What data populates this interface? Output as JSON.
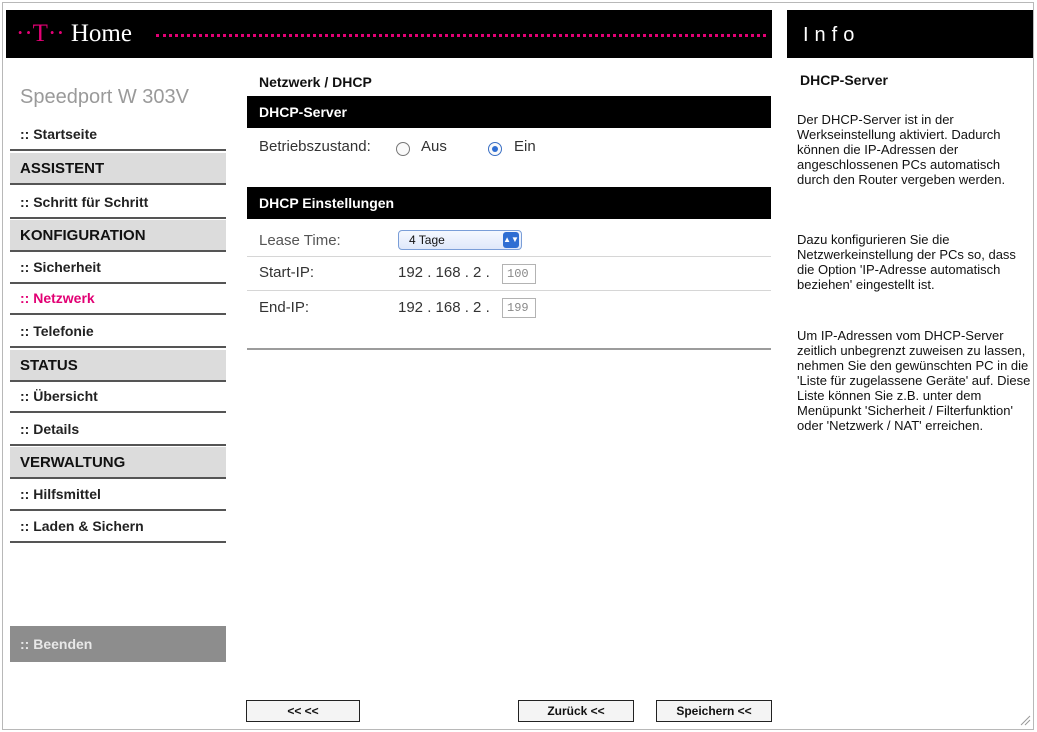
{
  "header": {
    "brand_t": "T",
    "brand_home": "Home",
    "info_title": "Info"
  },
  "sidebar": {
    "device": "Speedport W 303V",
    "items": [
      {
        "label": ":: Startseite"
      },
      {
        "label": "ASSISTENT"
      },
      {
        "label": ":: Schritt für Schritt"
      },
      {
        "label": "KONFIGURATION"
      },
      {
        "label": ":: Sicherheit"
      },
      {
        "label": ":: Netzwerk"
      },
      {
        "label": ":: Telefonie"
      },
      {
        "label": "STATUS"
      },
      {
        "label": ":: Übersicht"
      },
      {
        "label": ":: Details"
      },
      {
        "label": "VERWALTUNG"
      },
      {
        "label": ":: Hilfsmittel"
      },
      {
        "label": ":: Laden & Sichern"
      }
    ],
    "exit": ":: Beenden"
  },
  "main": {
    "breadcrumb": "Netzwerk / DHCP",
    "dhcp_server": {
      "heading": "DHCP-Server",
      "state_label": "Betriebszustand:",
      "off_label": "Aus",
      "on_label": "Ein",
      "selected": "Ein"
    },
    "settings": {
      "heading": "DHCP Einstellungen",
      "lease_label": "Lease Time:",
      "lease_value": "4 Tage",
      "start_label": "Start-IP:",
      "start_prefix": "192 . 168 . 2 .",
      "start_last": "100",
      "end_label": "End-IP:",
      "end_prefix": "192 . 168 . 2 .",
      "end_last": "199"
    }
  },
  "buttons": {
    "back": "<< <<",
    "zurueck": "Zurück <<",
    "speichern": "Speichern <<"
  },
  "info": {
    "title": "DHCP-Server",
    "p1": "Der DHCP-Server ist in der Werkseinstellung aktiviert. Dadurch können die IP-Adressen der angeschlossenen PCs automatisch durch den Router vergeben werden.",
    "p2": "Dazu konfigurieren Sie die Netzwerkeinstellung der PCs so, dass die Option 'IP-Adresse automatisch beziehen' eingestellt ist.",
    "p3": "Um IP-Adressen vom DHCP-Server zeitlich unbegrenzt zuweisen zu lassen, nehmen Sie den gewünschten PC in die 'Liste für zugelassene Geräte' auf. Diese Liste können Sie z.B. unter dem Menüpunkt 'Sicherheit / Filterfunktion' oder 'Netzwerk / NAT' erreichen."
  },
  "colors": {
    "magenta": "#e20074",
    "header": "#000000",
    "radio_active": "#2f6ed3"
  }
}
